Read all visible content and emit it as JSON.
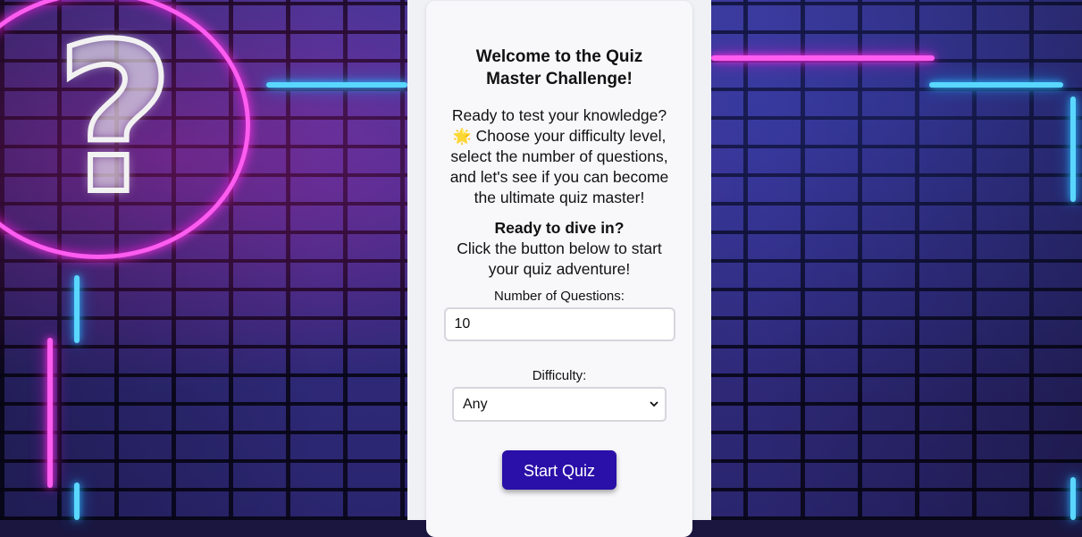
{
  "quiz": {
    "title": "Welcome to the Quiz Master Challenge!",
    "intro_part1": "Ready to test your knowledge?",
    "intro_emoji": "🌟",
    "intro_part2": "Choose your difficulty level, select the number of questions, and let's see if you can become the ultimate quiz master!",
    "dive_title": "Ready to dive in?",
    "dive_text": "Click the button below to start your quiz adventure!",
    "num_questions_label": "Number of Questions:",
    "num_questions_value": "10",
    "difficulty_label": "Difficulty:",
    "difficulty_value": "Any",
    "start_button": "Start Quiz"
  },
  "background": {
    "icon": "neon-question-bubble-icon",
    "colors": {
      "neon_pink": "#ff5cf0",
      "neon_blue": "#5ad7ff",
      "button": "#2a0fa8"
    }
  }
}
